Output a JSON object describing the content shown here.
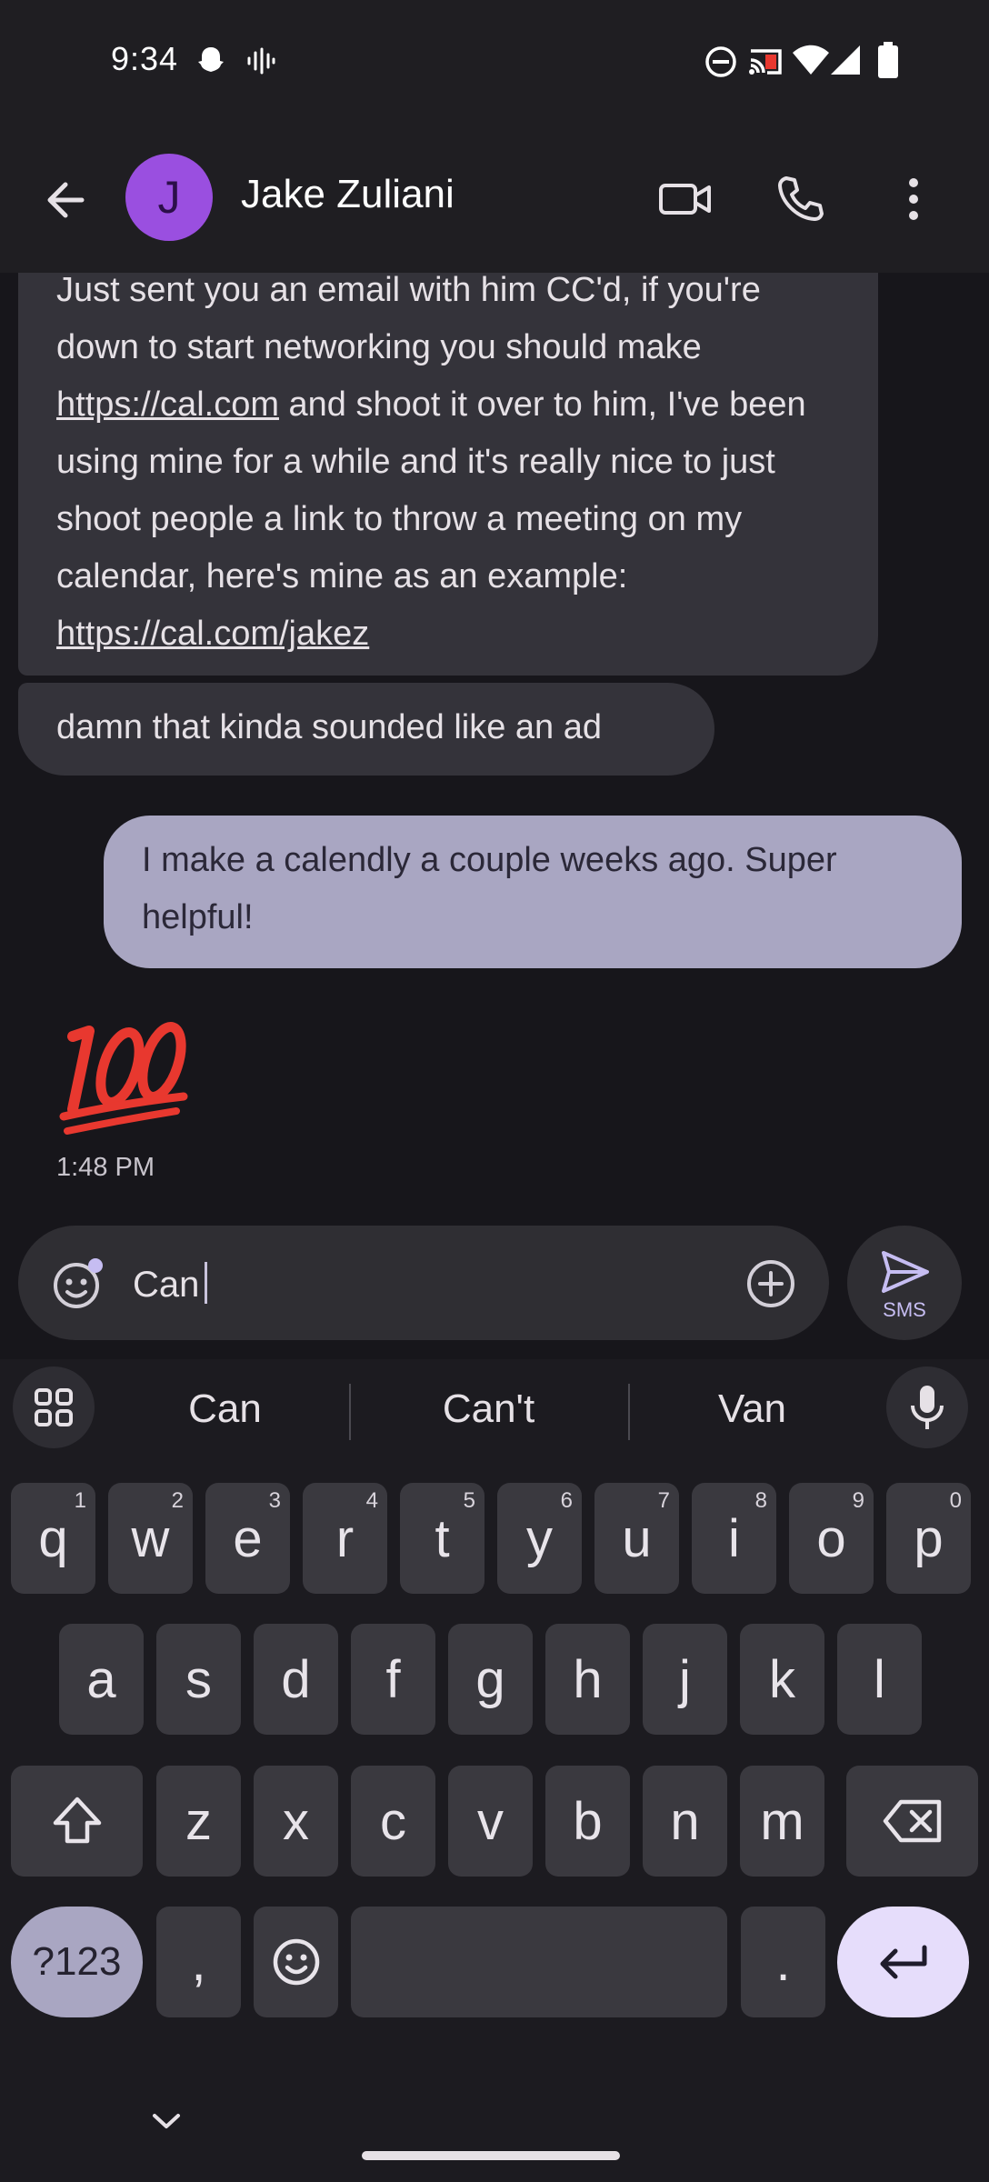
{
  "status_bar": {
    "time": "9:34",
    "icons_left": [
      "snapchat-icon",
      "voice-recorder-icon"
    ],
    "icons_right": [
      "do-not-disturb-icon",
      "cast-icon",
      "wifi-icon",
      "signal-icon",
      "battery-icon"
    ]
  },
  "header": {
    "avatar_initial": "J",
    "contact_name": "Jake Zuliani",
    "actions": [
      "video-call-icon",
      "phone-icon",
      "more-options-icon"
    ]
  },
  "messages": {
    "incoming_1": {
      "text_before_link1": "Just sent you an email with him CC'd, if you're down to start networking you should make ",
      "link1": "https://cal.com",
      "text_after_link1": " and shoot it over to him, I've been using mine for a while and it's really nice to just shoot people a link to throw a meeting on my calendar, here's mine as an example: ",
      "link2": "https://cal.com/jakez"
    },
    "incoming_2": "damn that kinda sounded like an ad",
    "outgoing_1": "I make a calendly a couple weeks ago. Super helpful!",
    "reaction_emoji": "💯",
    "timestamp": "1:48 PM"
  },
  "composer": {
    "value": "Can",
    "send_label": "SMS"
  },
  "keyboard": {
    "suggestions": [
      "Can",
      "Can't",
      "Van"
    ],
    "row1": [
      {
        "k": "q",
        "h": "1"
      },
      {
        "k": "w",
        "h": "2"
      },
      {
        "k": "e",
        "h": "3"
      },
      {
        "k": "r",
        "h": "4"
      },
      {
        "k": "t",
        "h": "5"
      },
      {
        "k": "y",
        "h": "6"
      },
      {
        "k": "u",
        "h": "7"
      },
      {
        "k": "i",
        "h": "8"
      },
      {
        "k": "o",
        "h": "9"
      },
      {
        "k": "p",
        "h": "0"
      }
    ],
    "row2": [
      "a",
      "s",
      "d",
      "f",
      "g",
      "h",
      "j",
      "k",
      "l"
    ],
    "row3": [
      "z",
      "x",
      "c",
      "v",
      "b",
      "n",
      "m"
    ],
    "symbols_label": "?123",
    "comma_label": ",",
    "period_label": "."
  },
  "colors": {
    "background": "#17161b",
    "incoming_bubble": "#34333a",
    "outgoing_bubble": "#a9a6c2",
    "avatar": "#9a4fe0",
    "reaction_red": "#e8382f"
  }
}
